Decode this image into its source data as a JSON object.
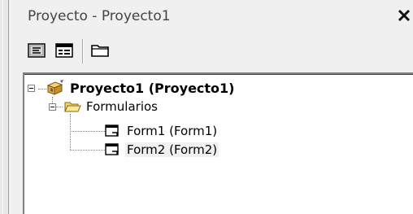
{
  "window": {
    "title": "Proyecto - Proyecto1",
    "close_glyph": "✕"
  },
  "toolbar": {
    "buttons": [
      {
        "name": "view-code-icon"
      },
      {
        "name": "view-object-icon"
      },
      {
        "name": "toggle-folders-icon"
      }
    ]
  },
  "tree": {
    "root": {
      "label": "Proyecto1 (Proyecto1)",
      "icon": "project-icon",
      "expanded": true
    },
    "folder": {
      "label": "Formularios",
      "icon": "folder-open-icon",
      "expanded": true
    },
    "items": [
      {
        "label": "Form1 (Form1)",
        "icon": "form-icon"
      },
      {
        "label": "Form2 (Form2)",
        "icon": "form-icon",
        "selected": true
      }
    ]
  }
}
